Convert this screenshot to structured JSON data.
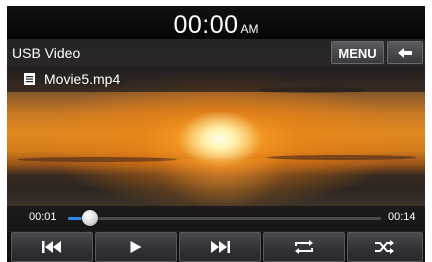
{
  "status": {
    "time": "00:00",
    "ampm": "AM"
  },
  "header": {
    "source_label": "USB Video",
    "menu_label": "MENU"
  },
  "file": {
    "name": "Movie5.mp4"
  },
  "playback": {
    "current_time": "00:01",
    "total_time": "00:14",
    "progress_fraction": 0.07
  },
  "controls": [
    "previous-icon",
    "play-icon",
    "next-icon",
    "repeat-icon",
    "shuffle-icon"
  ],
  "colors": {
    "accent": "#2a8ee8",
    "button_top": "#4a4a4e",
    "button_bottom": "#28282b"
  }
}
